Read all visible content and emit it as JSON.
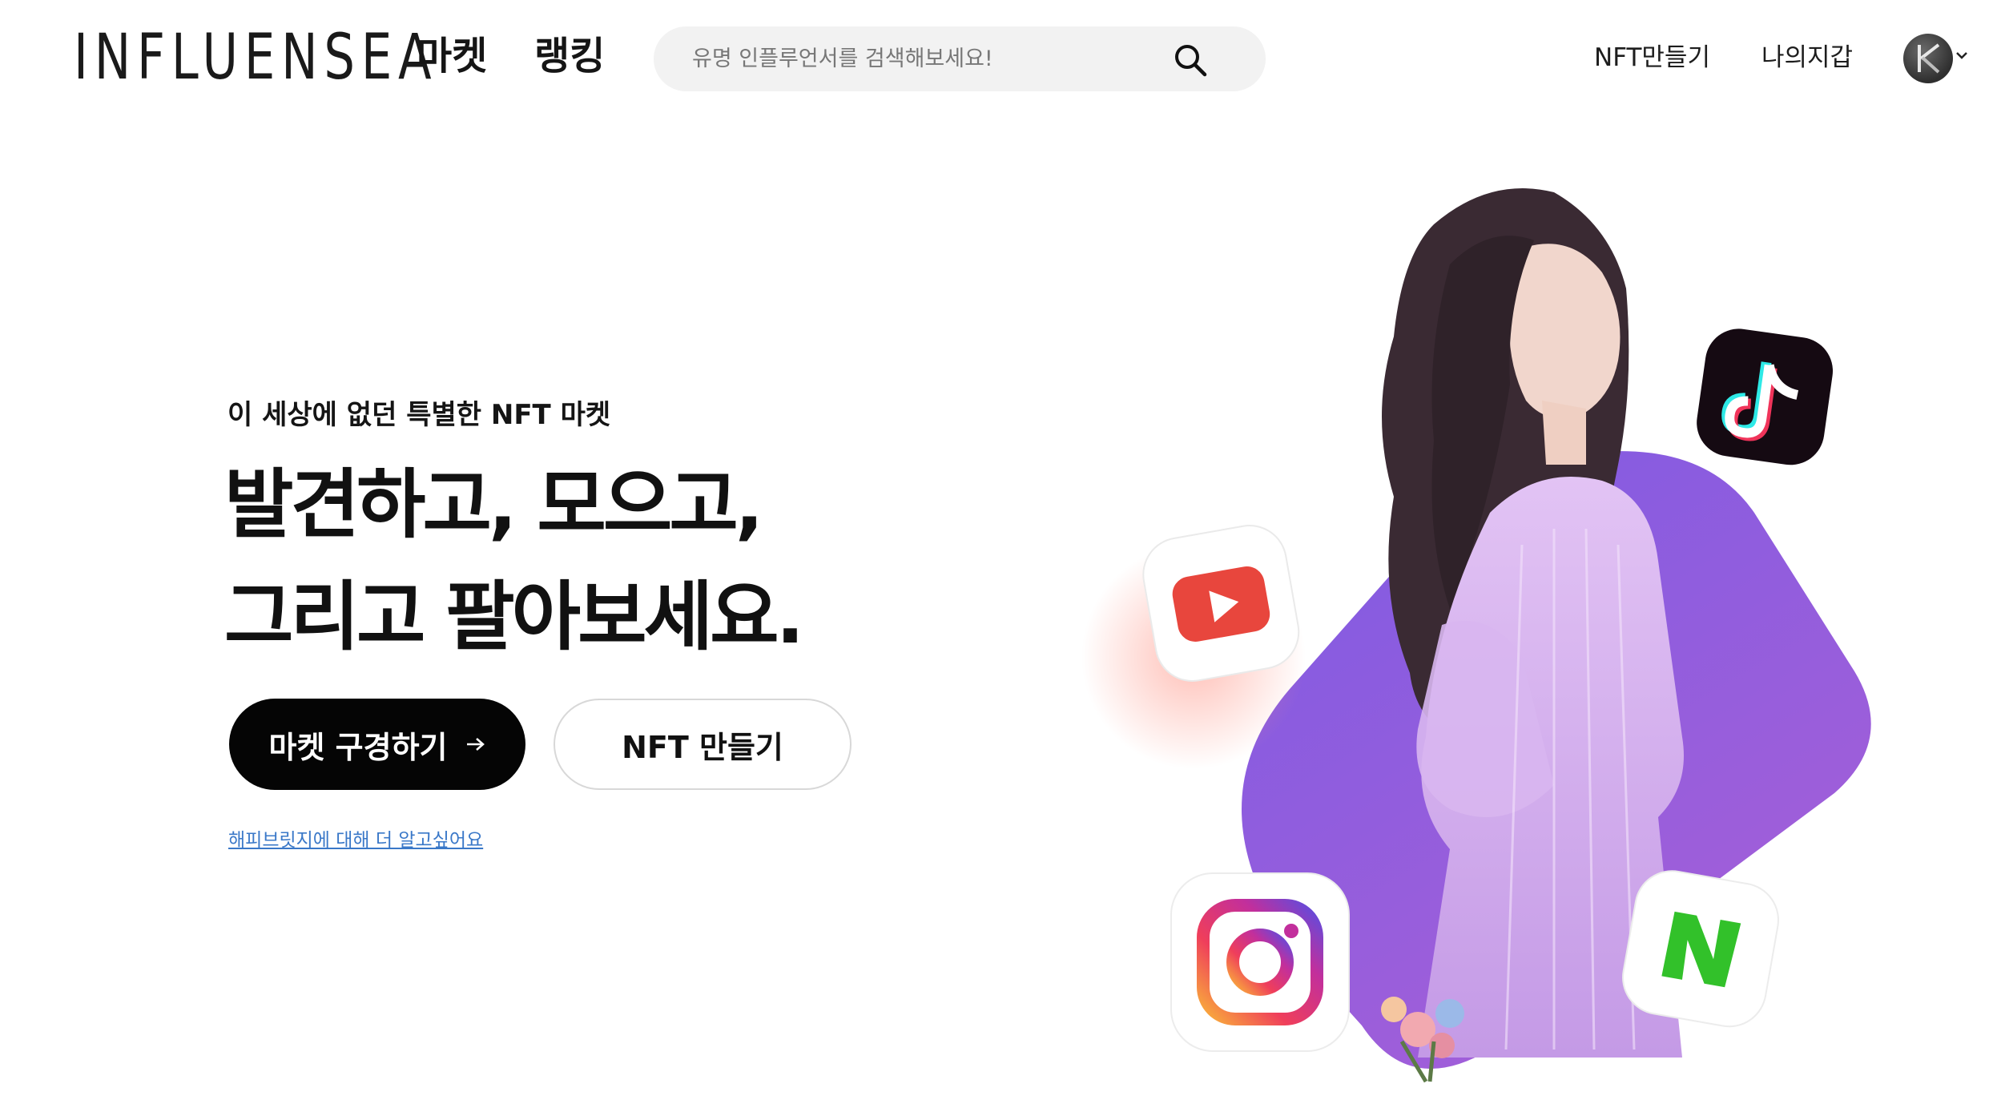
{
  "header": {
    "logo": "INFLUENSEA",
    "nav": {
      "market": "마켓",
      "ranking": "랭킹"
    },
    "search": {
      "placeholder": "유명 인플루언서를 검색해보세요!",
      "value": ""
    },
    "links": {
      "nft_create": "NFT만들기",
      "wallet": "나의지갑"
    }
  },
  "hero": {
    "subtitle": "이 세상에 없던 특별한 NFT 마켓",
    "title_line1": "발견하고, 모으고,",
    "title_line2": "그리고 팔아보세요.",
    "buttons": {
      "market": "마켓 구경하기",
      "nft_create": "NFT 만들기"
    },
    "learn_more": "해피브릿지에 대해 더 알고싶어요"
  },
  "social_icons": [
    "tiktok-icon",
    "youtube-icon",
    "instagram-icon",
    "naver-icon"
  ],
  "colors": {
    "accent_purple": "#8a5ee0",
    "primary_button": "#050505",
    "link_blue": "#3a78c8",
    "search_bg": "#f2f2f2"
  }
}
